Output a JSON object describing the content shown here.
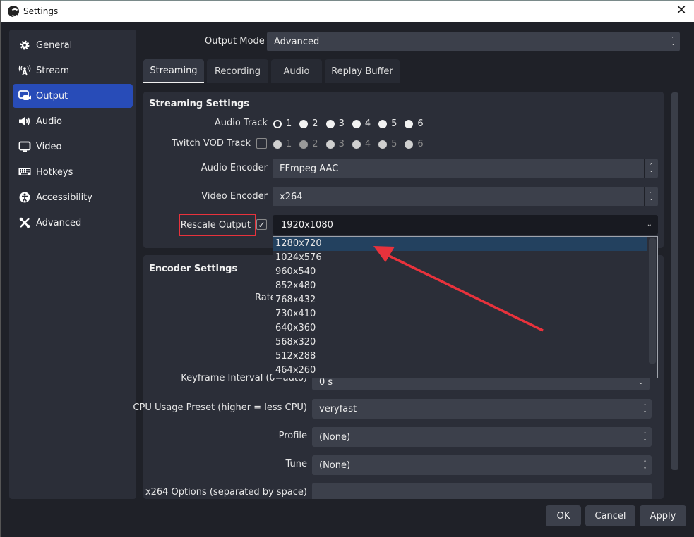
{
  "window": {
    "title": "Settings",
    "close_icon": "close-icon"
  },
  "sidebar": {
    "items": [
      {
        "label": "General",
        "icon": "gear-icon",
        "glyph": "⚙"
      },
      {
        "label": "Stream",
        "icon": "antenna-icon",
        "glyph": "📡"
      },
      {
        "label": "Output",
        "icon": "output-icon",
        "glyph": "▣",
        "active": true
      },
      {
        "label": "Audio",
        "icon": "speaker-icon",
        "glyph": "🔊"
      },
      {
        "label": "Video",
        "icon": "monitor-icon",
        "glyph": "▭"
      },
      {
        "label": "Hotkeys",
        "icon": "keyboard-icon",
        "glyph": "⌨"
      },
      {
        "label": "Accessibility",
        "icon": "accessibility-icon",
        "glyph": "♿"
      },
      {
        "label": "Advanced",
        "icon": "tools-icon",
        "glyph": "✂"
      }
    ]
  },
  "output_mode": {
    "label": "Output Mode",
    "value": "Advanced"
  },
  "tabs": [
    {
      "label": "Streaming",
      "active": true
    },
    {
      "label": "Recording"
    },
    {
      "label": "Audio"
    },
    {
      "label": "Replay Buffer"
    }
  ],
  "streaming_settings": {
    "title": "Streaming Settings",
    "audio_track": {
      "label": "Audio Track",
      "options": [
        "1",
        "2",
        "3",
        "4",
        "5",
        "6"
      ],
      "selected": "1"
    },
    "twitch_vod_track": {
      "label": "Twitch VOD Track",
      "checked": false,
      "options": [
        "1",
        "2",
        "3",
        "4",
        "5",
        "6"
      ],
      "selected": "2"
    },
    "audio_encoder": {
      "label": "Audio Encoder",
      "value": "FFmpeg AAC"
    },
    "video_encoder": {
      "label": "Video Encoder",
      "value": "x264"
    },
    "rescale_output": {
      "label": "Rescale Output",
      "checked": true,
      "value": "1920x1080"
    }
  },
  "rescale_dropdown": {
    "options": [
      "1280x720",
      "1024x576",
      "960x540",
      "852x480",
      "768x432",
      "730x410",
      "640x360",
      "568x320",
      "512x288",
      "464x260"
    ],
    "highlighted": "1280x720"
  },
  "encoder_settings": {
    "title": "Encoder Settings",
    "rate_control_label": "Rate",
    "keyframe_interval": {
      "label": "Keyframe Interval (0=auto)",
      "value": "0 s"
    },
    "cpu_usage_preset": {
      "label": "CPU Usage Preset (higher = less CPU)",
      "value": "veryfast"
    },
    "profile": {
      "label": "Profile",
      "value": "(None)"
    },
    "tune": {
      "label": "Tune",
      "value": "(None)"
    },
    "x264_options": {
      "label": "x264 Options (separated by space)",
      "value": ""
    }
  },
  "buttons": {
    "ok": "OK",
    "cancel": "Cancel",
    "apply": "Apply"
  },
  "annotation": {
    "color": "#e8323c"
  }
}
